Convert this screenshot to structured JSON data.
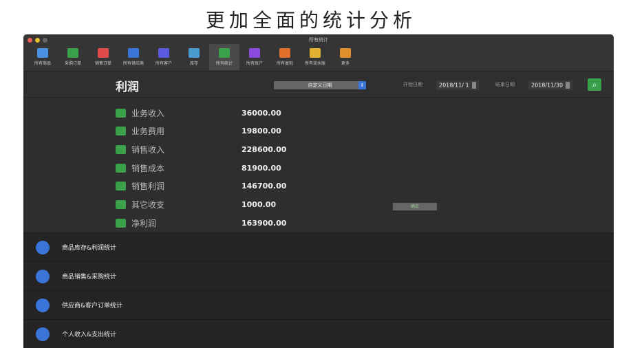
{
  "headline": "更加全面的统计分析",
  "window": {
    "title": "所有统计"
  },
  "toolbar": [
    {
      "label": "所有商品",
      "color": "#4a8fe0"
    },
    {
      "label": "采购订单",
      "color": "#3aa14a"
    },
    {
      "label": "销售订单",
      "color": "#e04a4a"
    },
    {
      "label": "所有供应商",
      "color": "#3a74d8"
    },
    {
      "label": "所有客户",
      "color": "#5a5ae0"
    },
    {
      "label": "库存",
      "color": "#4a9ad0"
    },
    {
      "label": "所有统计",
      "color": "#3aa14a"
    },
    {
      "label": "所有账户",
      "color": "#8a4ae0"
    },
    {
      "label": "所有类别",
      "color": "#e0702a"
    },
    {
      "label": "所有流水账",
      "color": "#e0b030"
    },
    {
      "label": "更多",
      "color": "#e0902a"
    }
  ],
  "header": {
    "title": "利润",
    "range_select": "自定义日期",
    "start_label": "开始日期",
    "start_date": "2018/11/ 1",
    "end_label": "结束日期",
    "end_date": "2018/11/30"
  },
  "rows": [
    {
      "label": "业务收入",
      "value": "36000.00"
    },
    {
      "label": "业务费用",
      "value": "19800.00"
    },
    {
      "label": "销售收入",
      "value": "228600.00"
    },
    {
      "label": "销售成本",
      "value": "81900.00"
    },
    {
      "label": "销售利润",
      "value": "146700.00"
    },
    {
      "label": "其它收支",
      "value": "1000.00"
    },
    {
      "label": "净利润",
      "value": "163900.00"
    }
  ],
  "small_button": "确定",
  "nav": [
    {
      "label": "商品库存&利润统计"
    },
    {
      "label": "商品销售&采购统计"
    },
    {
      "label": "供应商&客户订单统计"
    },
    {
      "label": "个人收入&支出统计"
    }
  ]
}
